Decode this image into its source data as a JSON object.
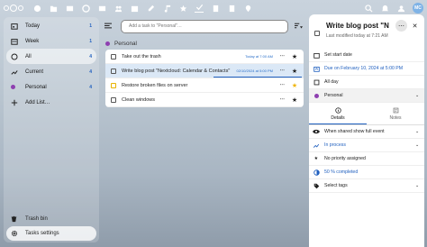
{
  "sidebar": {
    "items": [
      {
        "label": "Today",
        "count": "1"
      },
      {
        "label": "Week",
        "count": "1"
      },
      {
        "label": "All",
        "count": "4"
      },
      {
        "label": "Current",
        "count": "4"
      },
      {
        "label": "Personal",
        "count": "4"
      },
      {
        "label": "Add List…",
        "count": ""
      }
    ],
    "trash_label": "Trash bin",
    "settings_label": "Tasks settings"
  },
  "topbar": {
    "avatar_initials": "MC"
  },
  "main": {
    "add_placeholder": "Add a task to \"Personal\"…",
    "list_name": "Personal",
    "tasks": [
      {
        "title": "Take out the trash",
        "date": "Today at 7:00 AM"
      },
      {
        "title": "Write blog post \"Nextcloud: Calendar & Contacts\"",
        "date": "02/10/2024 at 5:00 PM"
      },
      {
        "title": "Restore broken files on server",
        "date": ""
      },
      {
        "title": "Clean windows",
        "date": ""
      }
    ]
  },
  "panel": {
    "title": "Write blog post \"Ne...",
    "subtitle": "Last modified today at 7:21 AM",
    "start_date": "Set start date",
    "due": "Due on February 10, 2024 at 5:00 PM",
    "all_day": "All day",
    "list": "Personal",
    "tab_details": "Details",
    "tab_notes": "Notes",
    "class": "When shared show full event",
    "status": "In process",
    "priority": "No priority assigned",
    "progress": "50 % completed",
    "tags": "Select tags"
  },
  "colors": {
    "accent": "#1f5fbf",
    "list_dot": "#8e3fb0",
    "star_gold": "#f0b400"
  }
}
